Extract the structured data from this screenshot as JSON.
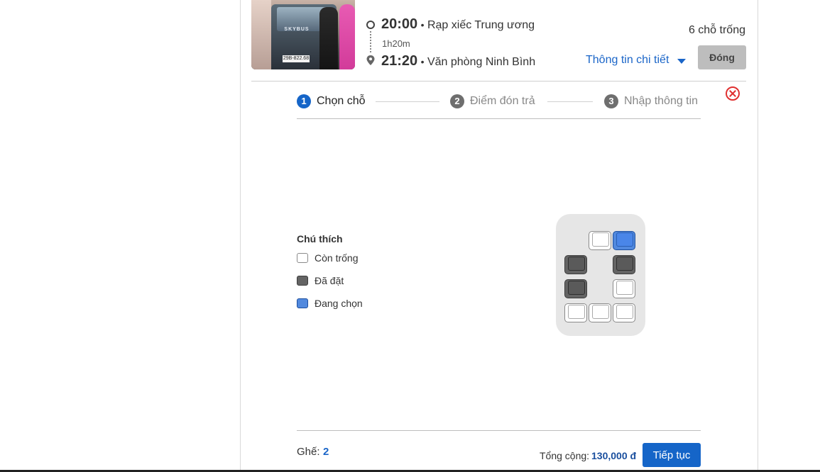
{
  "trip": {
    "depart_time": "20:00",
    "depart_place": "Rạp xiếc Trung ương",
    "duration": "1h20m",
    "arrive_time": "21:20",
    "arrive_place": "Văn phòng Ninh Bình",
    "separator": "•",
    "seats_left": "6 chỗ trống",
    "details_link": "Thông tin chi tiết",
    "close_button": "Đóng",
    "bus_logo": "SKYBUS",
    "plate": "29B-822.68"
  },
  "steps": [
    {
      "number": "1",
      "label": "Chọn chỗ",
      "active": true
    },
    {
      "number": "2",
      "label": "Điểm đón trả",
      "active": false
    },
    {
      "number": "3",
      "label": "Nhập thông tin",
      "active": false
    }
  ],
  "legend": {
    "title": "Chú thích",
    "items": [
      {
        "label": "Còn trống",
        "state": "empty"
      },
      {
        "label": "Đã đặt",
        "state": "booked"
      },
      {
        "label": "Đang chọn",
        "state": "selected"
      }
    ]
  },
  "seat_map": {
    "rows": [
      [
        "none",
        "empty",
        "selected"
      ],
      [
        "booked",
        "none",
        "booked"
      ],
      [
        "booked",
        "none",
        "empty"
      ],
      [
        "empty",
        "empty",
        "empty"
      ]
    ]
  },
  "footer": {
    "seat_label": "Ghế:",
    "seat_count": "2",
    "total_label": "Tổng cộng:",
    "total_value": "130,000 đ",
    "continue_button": "Tiếp tục"
  },
  "colors": {
    "accent": "#1565c8",
    "booked": "#646464",
    "selected": "#4a86e8",
    "close_x": "#e03030"
  }
}
